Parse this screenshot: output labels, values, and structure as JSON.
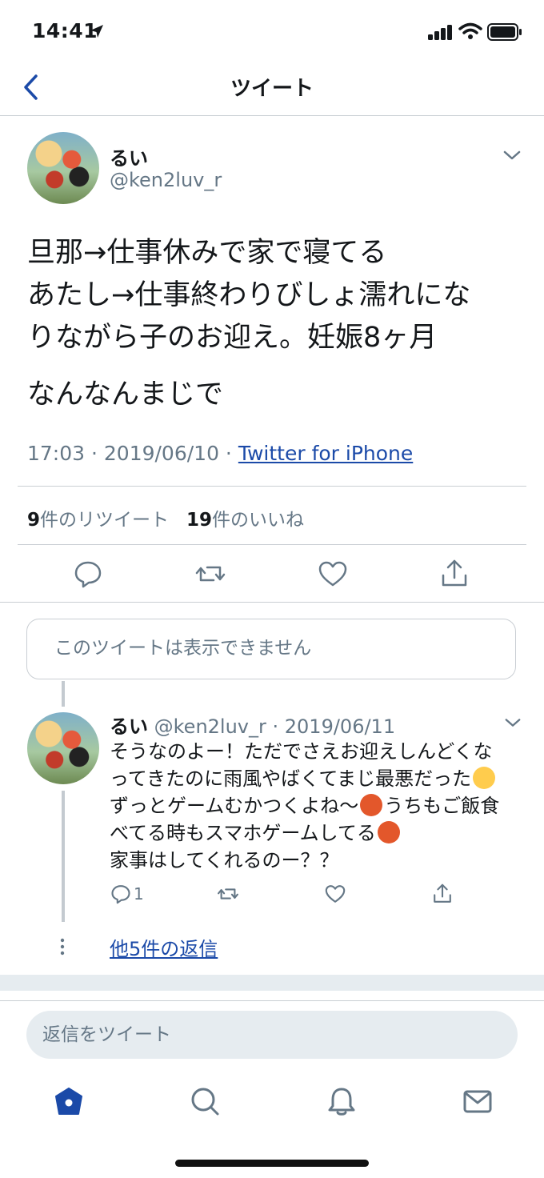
{
  "status_bar": {
    "time": "14:41"
  },
  "nav": {
    "title": "ツイート"
  },
  "tweet": {
    "name": "るい",
    "handle": "@ken2luv_r",
    "lines": [
      "旦那→仕事休みで家で寝てる",
      "あたし→仕事終わりびしょ濡れにな",
      "りながら子のお迎え。妊娠8ヶ月"
    ],
    "line_last": "なんなんまじで",
    "time": "17:03 · 2019/06/10 · ",
    "source": "Twitter for iPhone",
    "retweet_count": "9",
    "retweet_label": "件のリツイート",
    "like_count": "19",
    "like_label": "件のいいね"
  },
  "notice": {
    "text": "このツイートは表示できません"
  },
  "reply": {
    "name": "るい",
    "handle_date": "@ken2luv_r · 2019/06/11",
    "lines": [
      "そうなのよー！ただでさえお迎えしんどくな",
      "ってきたのに雨風やばくてまじ最悪だった",
      "ずっとゲームむかつくよね〜",
      "うちもご飯食",
      "べてる時もスマホゲームしてる",
      "家事はしてくれるのー？？"
    ],
    "reply_count": "1",
    "more_replies": "他5件の返信"
  },
  "composer": {
    "placeholder": "返信をツイート"
  },
  "colors": {
    "accent": "#1b4aa8",
    "muted": "#657786",
    "divider": "#c9ced3"
  },
  "icons": [
    "back-chevron-icon",
    "chevron-down-icon",
    "reply-icon",
    "retweet-icon",
    "like-icon",
    "share-icon",
    "home-icon",
    "search-icon",
    "notifications-icon",
    "messages-icon"
  ]
}
